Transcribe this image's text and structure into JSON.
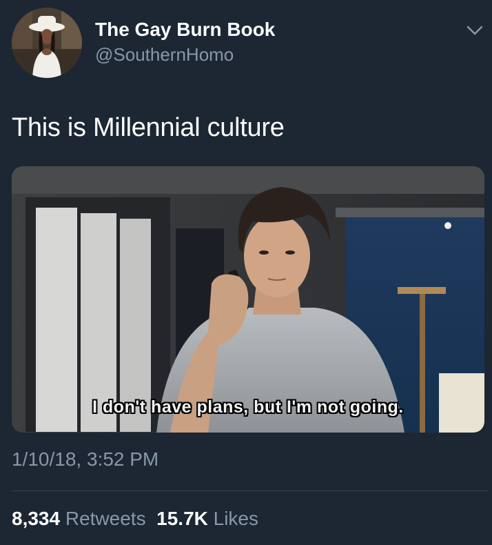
{
  "user": {
    "display_name": "The Gay Burn Book",
    "handle": "@SouthernHomo"
  },
  "tweet": {
    "text": "This is Millennial culture",
    "media_caption": "I don't have plans, but I'm not going.",
    "timestamp": "1/10/18, 3:52 PM"
  },
  "stats": {
    "retweets_count": "8,334",
    "retweets_label": "Retweets",
    "likes_count": "15.7K",
    "likes_label": "Likes"
  },
  "icons": {
    "menu": "chevron-down-icon"
  },
  "colors": {
    "background": "#1c2733",
    "secondary_text": "#8899a6",
    "primary_text": "#ffffff",
    "divider": "#38444d"
  }
}
